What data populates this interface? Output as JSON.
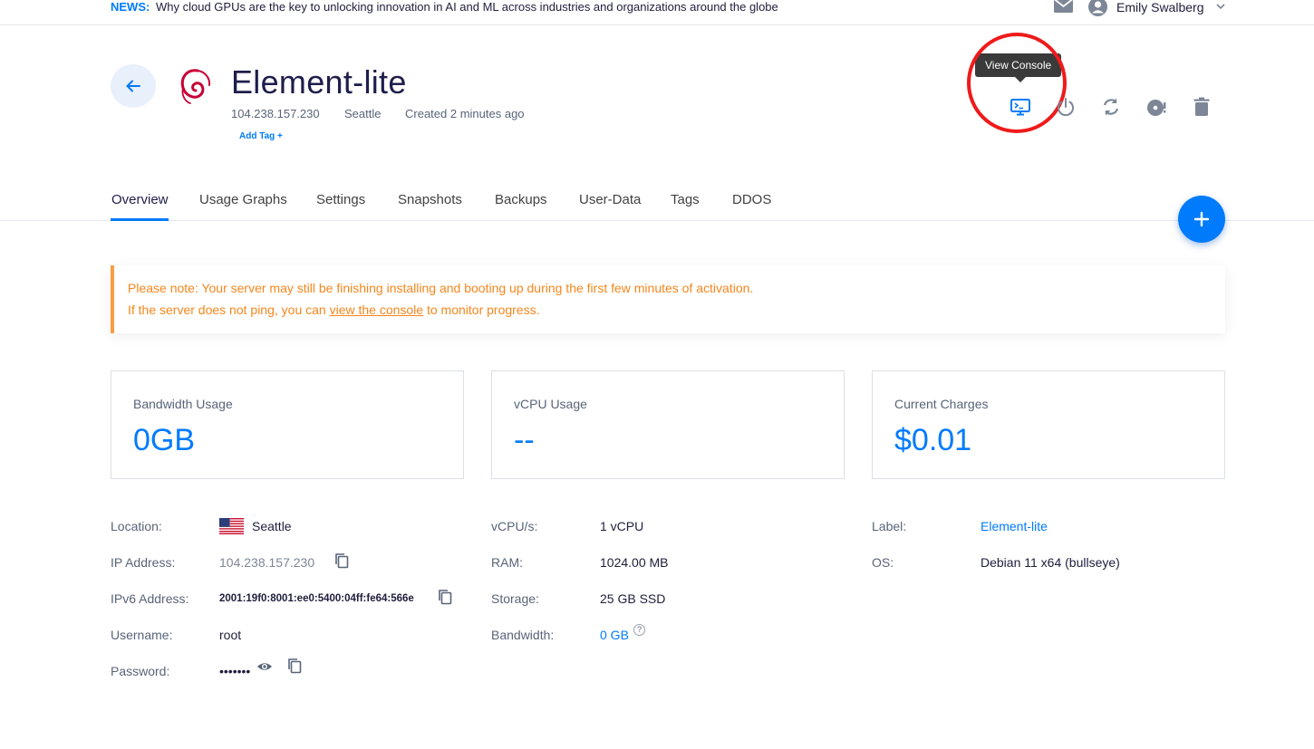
{
  "news": {
    "label": "NEWS:",
    "text": "Why cloud GPUs are the key to unlocking innovation in AI and ML across industries and organizations around the globe"
  },
  "user": {
    "name": "Emily Swalberg"
  },
  "server": {
    "title": "Element-lite",
    "ip": "104.238.157.230",
    "location": "Seattle",
    "created": "Created 2 minutes ago",
    "add_tag": "Add Tag +"
  },
  "tooltip": "View Console",
  "actions": [
    "console-icon",
    "power-icon",
    "restart-icon",
    "iso-icon",
    "trash-icon"
  ],
  "tabs": [
    "Overview",
    "Usage Graphs",
    "Settings",
    "Snapshots",
    "Backups",
    "User-Data",
    "Tags",
    "DDOS"
  ],
  "active_tab": "Overview",
  "notice": {
    "line1": "Please note: Your server may still be finishing installing and booting up during the first few minutes of activation.",
    "line2_before": "If the server does not ping, you can ",
    "line2_link": "view the console",
    "line2_after": " to monitor progress."
  },
  "cards": [
    {
      "label": "Bandwidth Usage",
      "value": "0GB"
    },
    {
      "label": "vCPU Usage",
      "value": "--"
    },
    {
      "label": "Current Charges",
      "value": "$0.01"
    }
  ],
  "details": {
    "col1": [
      {
        "label": "Location:",
        "value": "Seattle"
      },
      {
        "label": "IP Address:",
        "value": "104.238.157.230"
      },
      {
        "label": "IPv6 Address:",
        "value": "2001:19f0:8001:ee0:5400:04ff:fe64:566e"
      },
      {
        "label": "Username:",
        "value": "root"
      },
      {
        "label": "Password:",
        "value": "•••••••"
      }
    ],
    "col2": [
      {
        "label": "vCPU/s:",
        "value": "1 vCPU"
      },
      {
        "label": "RAM:",
        "value": "1024.00 MB"
      },
      {
        "label": "Storage:",
        "value": "25 GB SSD"
      },
      {
        "label": "Bandwidth:",
        "value": "0 GB",
        "help": "?"
      }
    ],
    "col3": [
      {
        "label": "Label:",
        "value": "Element-lite"
      },
      {
        "label": "OS:",
        "value": "Debian 11 x64 (bullseye)"
      }
    ]
  },
  "colors": {
    "accent": "#007bfc",
    "notice": "#f7861c",
    "highlight": "#ef1a1a",
    "title": "#1e1e4b"
  }
}
